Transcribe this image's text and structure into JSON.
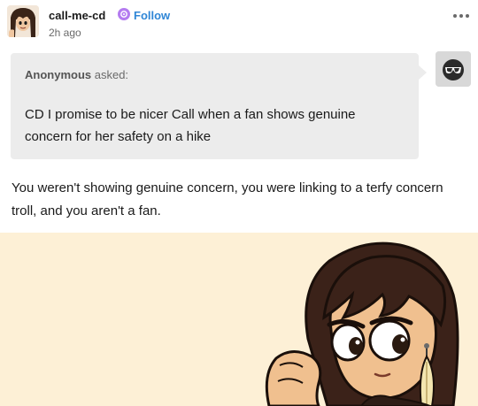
{
  "post": {
    "blog_name": "call-me-cd",
    "follow_label": "Follow",
    "timestamp": "2h ago"
  },
  "ask": {
    "asker_name": "Anonymous",
    "asker_verb": " asked:",
    "question": "CD I promise to be nicer Call when a fan shows genuine concern for her safety on a hike"
  },
  "answer": {
    "text": "You weren't showing genuine concern, you were linking to a terfy concern troll, and you aren't a fan."
  },
  "icons": {
    "avatar": "blog-avatar",
    "badge": "verified-badge-icon",
    "more": "more-options-icon",
    "anon": "anonymous-sunglasses-avatar"
  },
  "colors": {
    "follow": "#2f86d6",
    "badge": "#b47cf0",
    "ask_bg": "#ececec",
    "image_bg": "#fdf0d6"
  }
}
